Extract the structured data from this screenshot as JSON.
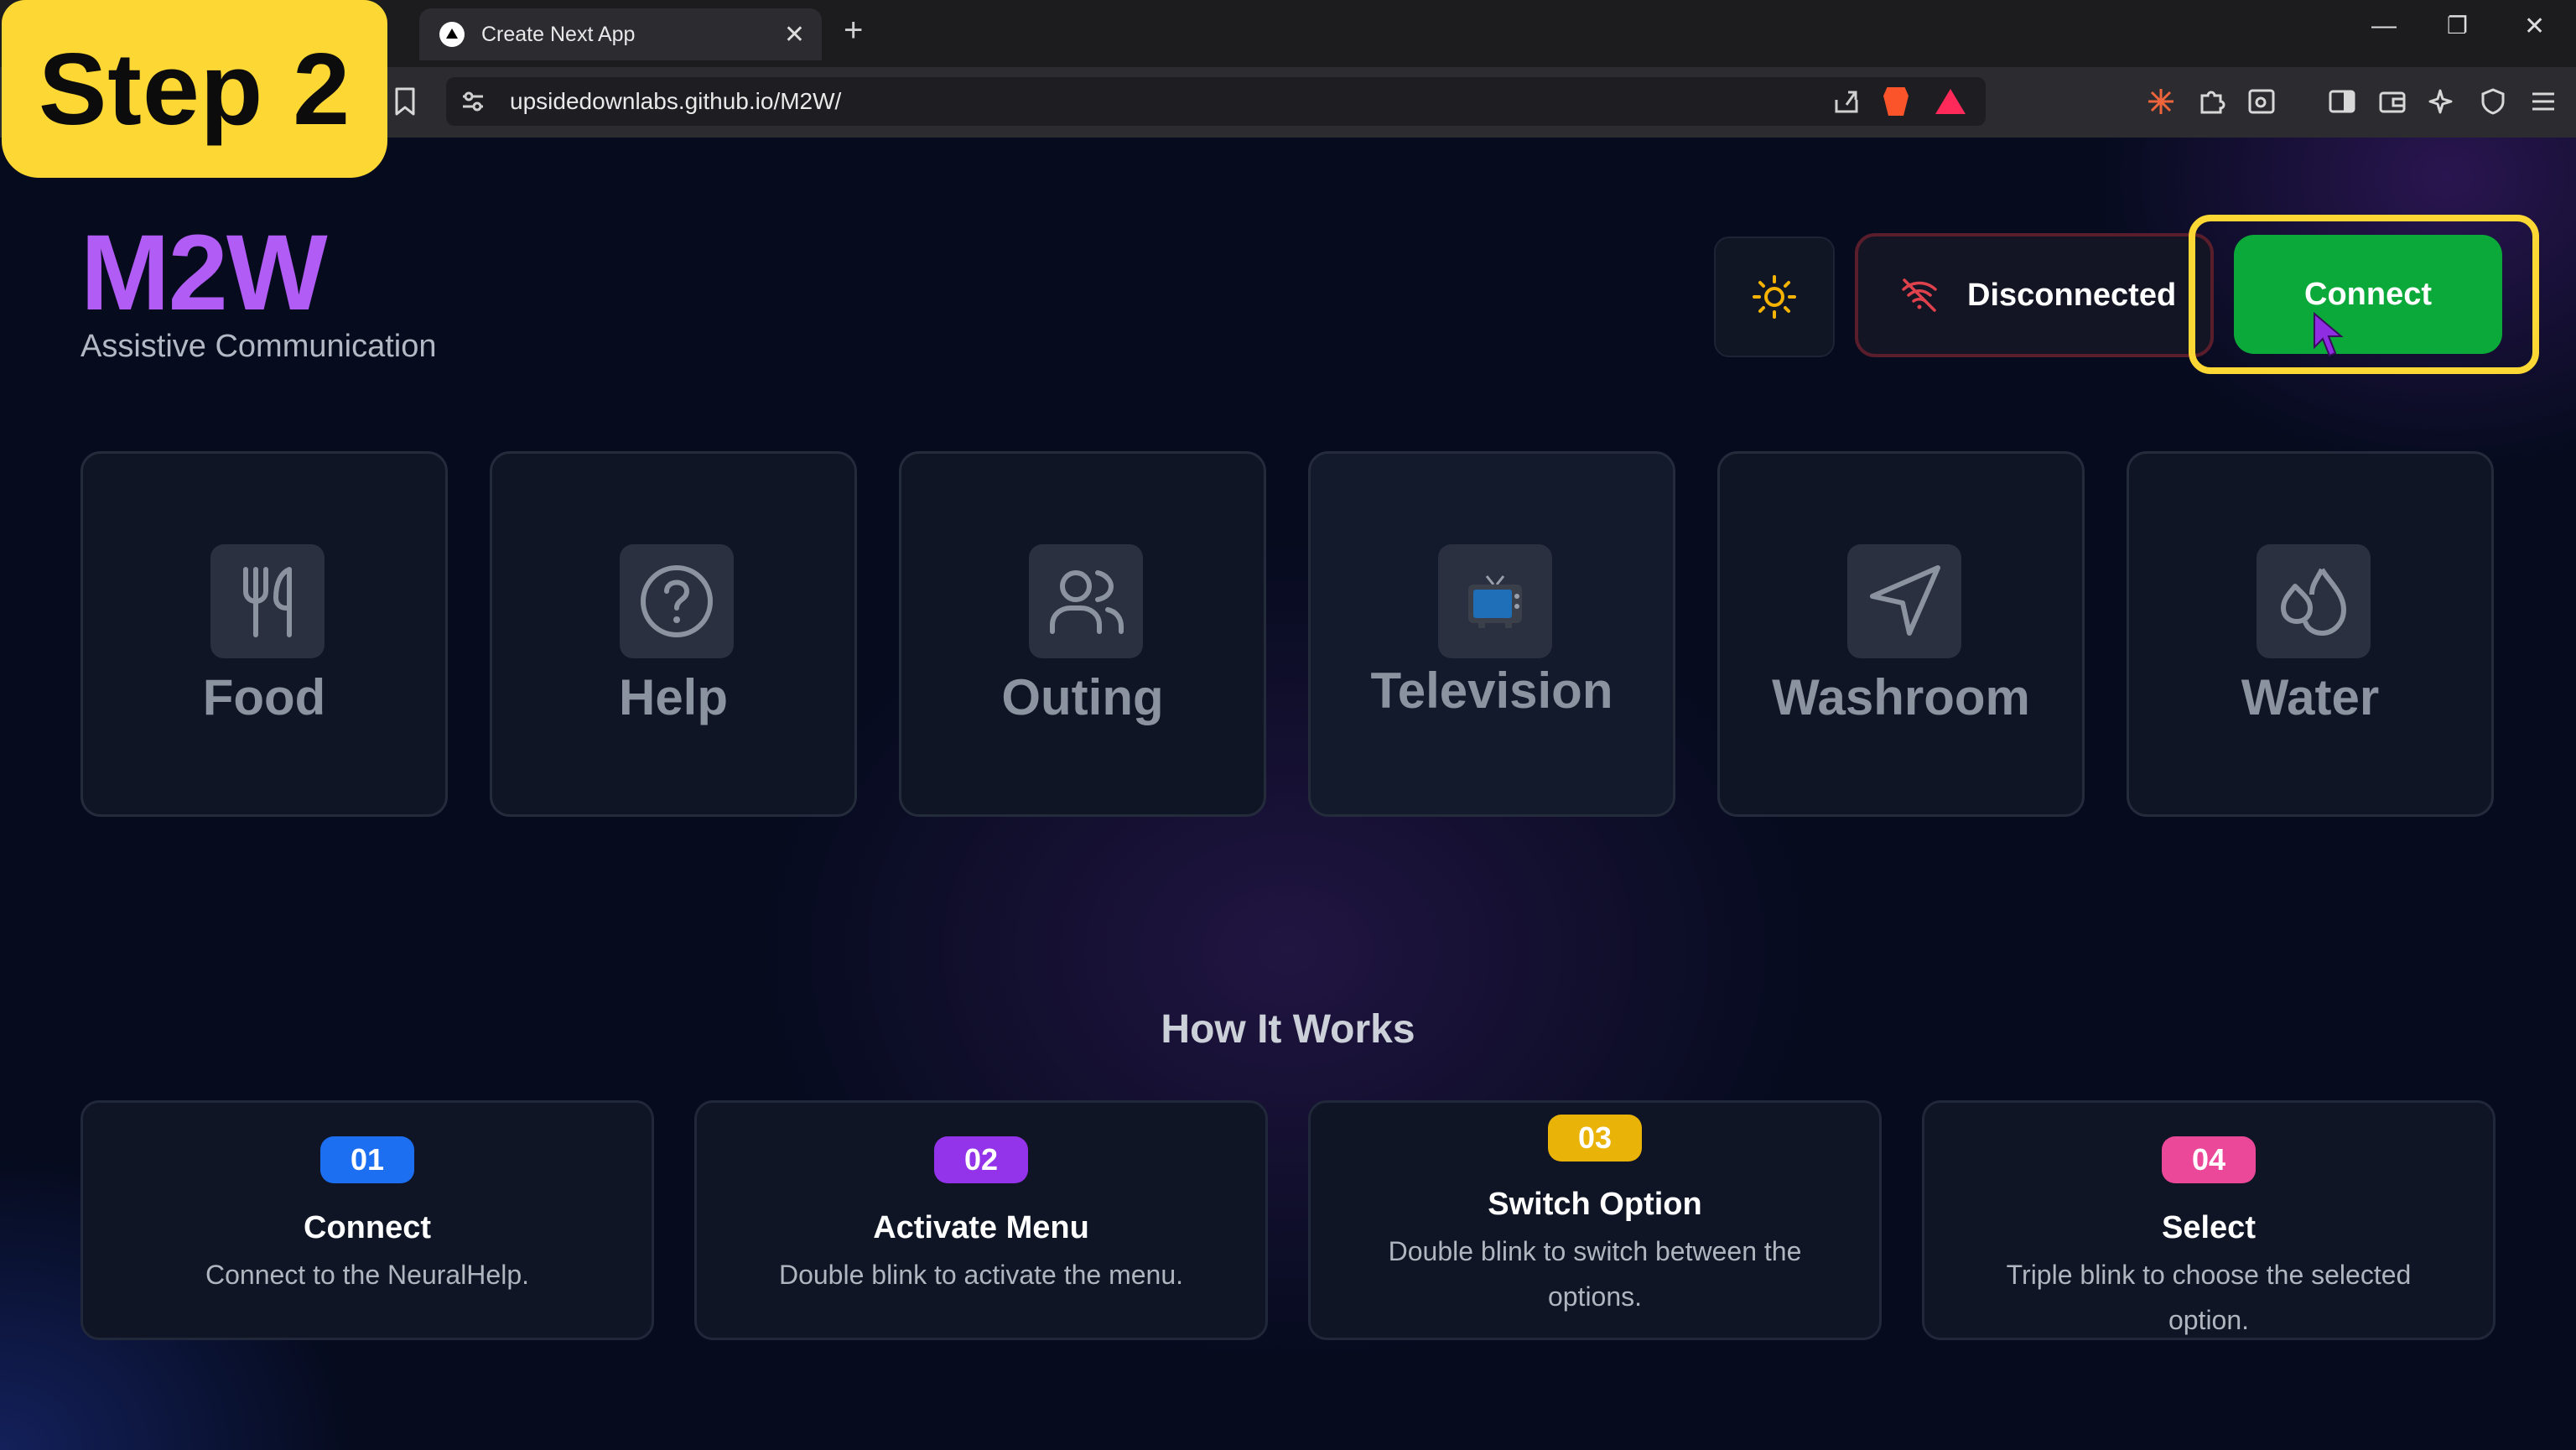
{
  "browser": {
    "tab_title": "Create Next App",
    "tab_close": "✕",
    "new_tab": "+",
    "url": "upsidedownlabs.github.io/M2W/",
    "window_controls": [
      "—",
      "❐",
      "✕"
    ]
  },
  "overlay": {
    "step_label": "Step 2"
  },
  "header": {
    "brand": "M2W",
    "subtitle": "Assistive Communication",
    "status": "Disconnected",
    "connect_label": "Connect"
  },
  "options": [
    {
      "label": "Food",
      "icon": "utensils-icon"
    },
    {
      "label": "Help",
      "icon": "help-circle-icon"
    },
    {
      "label": "Outing",
      "icon": "users-icon"
    },
    {
      "label": "Television",
      "icon": "television-icon"
    },
    {
      "label": "Washroom",
      "icon": "navigation-icon"
    },
    {
      "label": "Water",
      "icon": "droplets-icon"
    }
  ],
  "how_it_works": {
    "title": "How It Works",
    "steps": [
      {
        "number": "01",
        "title": "Connect",
        "description": "Connect to the NeuralHelp.",
        "color": "#1d6ff2"
      },
      {
        "number": "02",
        "title": "Activate Menu",
        "description": "Double blink to activate the menu.",
        "color": "#9333ea"
      },
      {
        "number": "03",
        "title": "Switch Option",
        "description": "Double blink to switch between the options.",
        "color": "#eab308"
      },
      {
        "number": "04",
        "title": "Select",
        "description": "Triple blink to choose the selected option.",
        "color": "#ec4899"
      }
    ]
  },
  "colors": {
    "brand": "#b15cf5",
    "connect": "#0ba83a",
    "highlight": "#fdd835",
    "disconnected_border": "#5a1d2c"
  }
}
